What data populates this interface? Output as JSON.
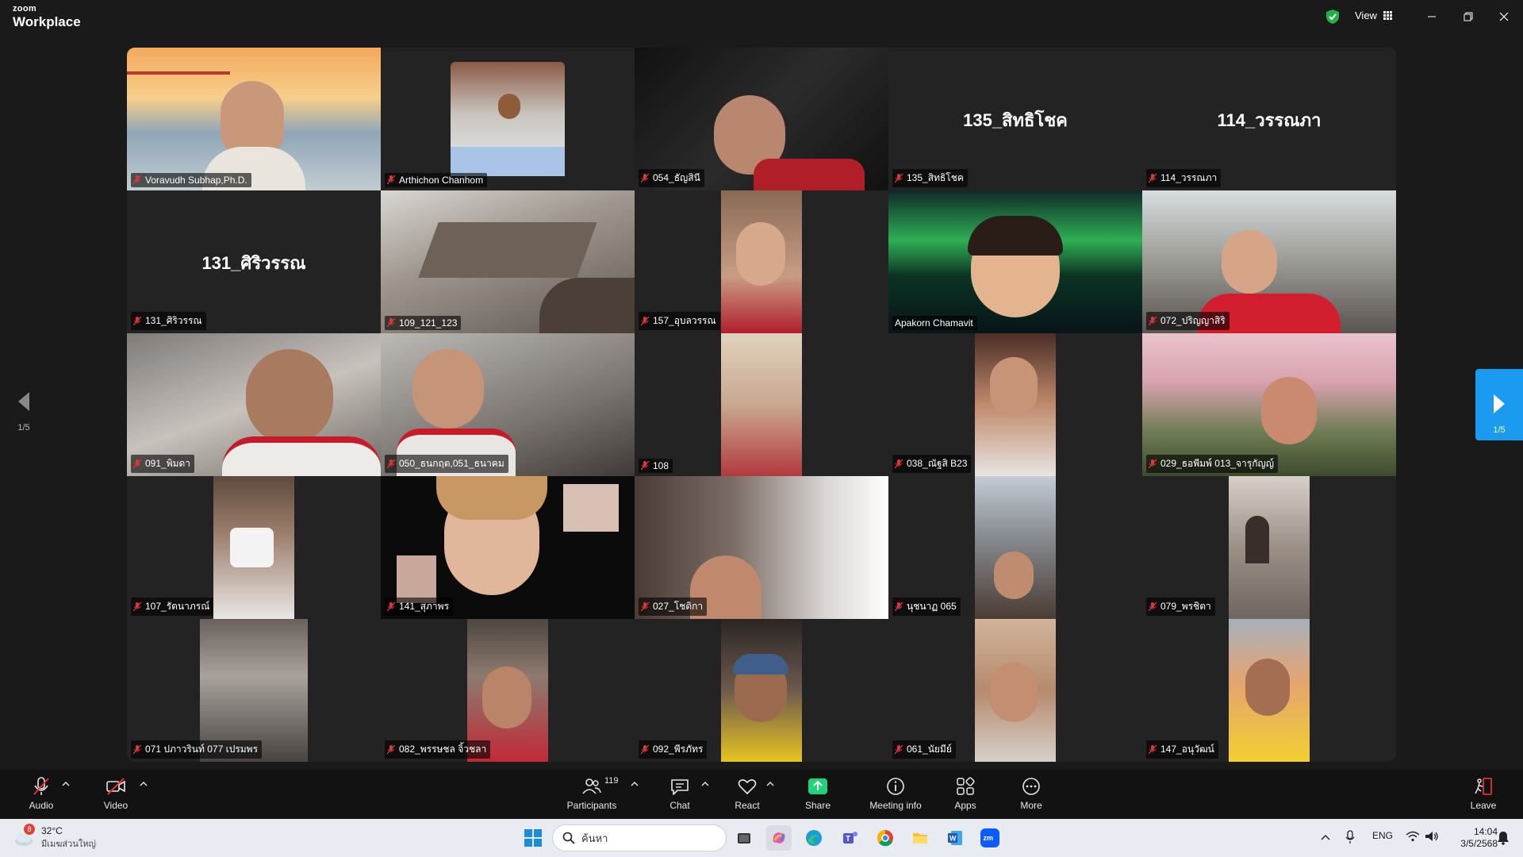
{
  "app": {
    "logo_line1": "zoom",
    "logo_line2": "Workplace",
    "view_label": "View"
  },
  "gallery": {
    "page_left": "1/5",
    "page_right": "1/5",
    "tiles": [
      {
        "name": "Voravudh Subhap,Ph.D.",
        "big": ""
      },
      {
        "name": "Arthichon Chanhom",
        "big": ""
      },
      {
        "name": "054_ธัญสินี",
        "big": ""
      },
      {
        "name": "135_สิทธิโชค",
        "big": "135_สิทธิโชค"
      },
      {
        "name": "114_วรรณภา",
        "big": "114_วรรณภา"
      },
      {
        "name": "131_ศิริวรรณ",
        "big": "131_ศิริวรรณ"
      },
      {
        "name": "109_121_123",
        "big": ""
      },
      {
        "name": "157_อุบลวรรณ",
        "big": ""
      },
      {
        "name": "Apakorn Chamavit",
        "big": ""
      },
      {
        "name": "072_ปริญญาสิริ",
        "big": ""
      },
      {
        "name": "091_พิมดา",
        "big": ""
      },
      {
        "name": "050_ธนกฤต,051_ธนาคม",
        "big": ""
      },
      {
        "name": "108",
        "big": ""
      },
      {
        "name": "038_ณัฐสิ B23",
        "big": ""
      },
      {
        "name": "029_ธอพีมพ์ 013_จารุกัญญ์",
        "big": ""
      },
      {
        "name": "107_รัตนาภรณ์",
        "big": ""
      },
      {
        "name": "141_สุภาพร",
        "big": ""
      },
      {
        "name": "027_โชติกา",
        "big": ""
      },
      {
        "name": "นุชนาฏ 065",
        "big": ""
      },
      {
        "name": "079_พรชิตา",
        "big": ""
      },
      {
        "name": "071 ปภาวรินท์ 077 เปรมพร",
        "big": ""
      },
      {
        "name": "082_พรรษชล จิ้วชลา",
        "big": ""
      },
      {
        "name": "092_พีรภัทร",
        "big": ""
      },
      {
        "name": "061_นัยมีย์",
        "big": ""
      },
      {
        "name": "147_อนุวัฒน์",
        "big": ""
      }
    ]
  },
  "toolbar": {
    "audio": "Audio",
    "video": "Video",
    "participants": "Participants",
    "participants_count": "119",
    "chat": "Chat",
    "react": "React",
    "share": "Share",
    "meeting_info": "Meeting info",
    "apps": "Apps",
    "more": "More",
    "leave": "Leave"
  },
  "taskbar": {
    "weather_badge": "8",
    "temperature": "32°C",
    "weather_desc": "มีเมฆส่วนใหญ่",
    "search_placeholder": "ค้นหา",
    "language": "ENG",
    "time": "14:04",
    "date": "3/5/2568"
  },
  "colors": {
    "active_speaker": "#2fd473",
    "share": "#1fd37a",
    "page_button": "#1a9bf0"
  }
}
